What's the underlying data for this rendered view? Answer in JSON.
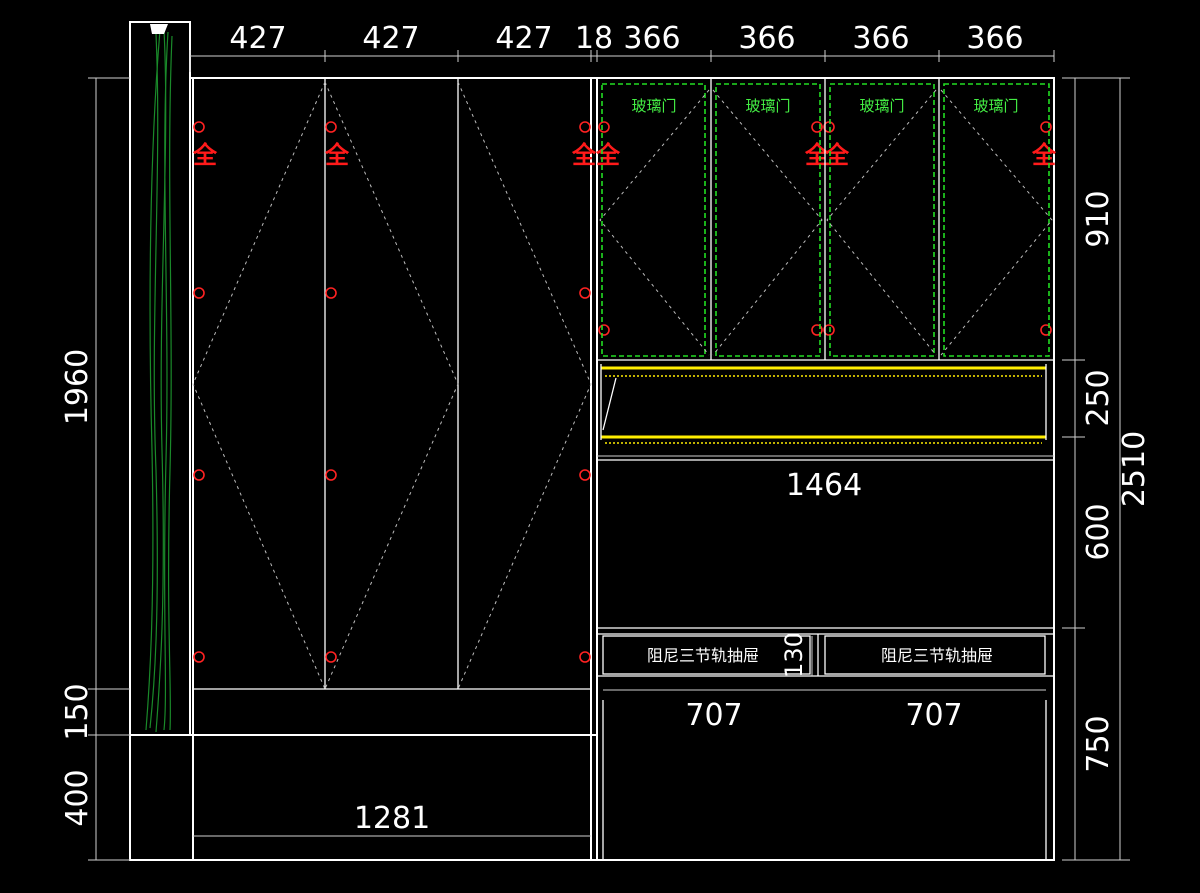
{
  "dimensions": {
    "top": [
      "427",
      "427",
      "427",
      "18",
      "366",
      "366",
      "366",
      "366"
    ],
    "left": [
      "1960",
      "150",
      "400"
    ],
    "right": [
      "910",
      "250",
      "600",
      "750"
    ],
    "overall_height": "2510",
    "upper_width": "1464",
    "bottom_width": "1281",
    "drawer_height": "130",
    "drawer_widths": [
      "707",
      "707"
    ]
  },
  "labels": {
    "glass_door": "玻璃门",
    "drawer": "阻尼三节轨抽屉",
    "hinge_mark": "全"
  },
  "colors": {
    "background": "#000000",
    "line": "#ffffff",
    "glass": "#22dd22",
    "hinge": "#ff2222",
    "rail": "#ffee00",
    "curtain": "#1a8a2a"
  }
}
